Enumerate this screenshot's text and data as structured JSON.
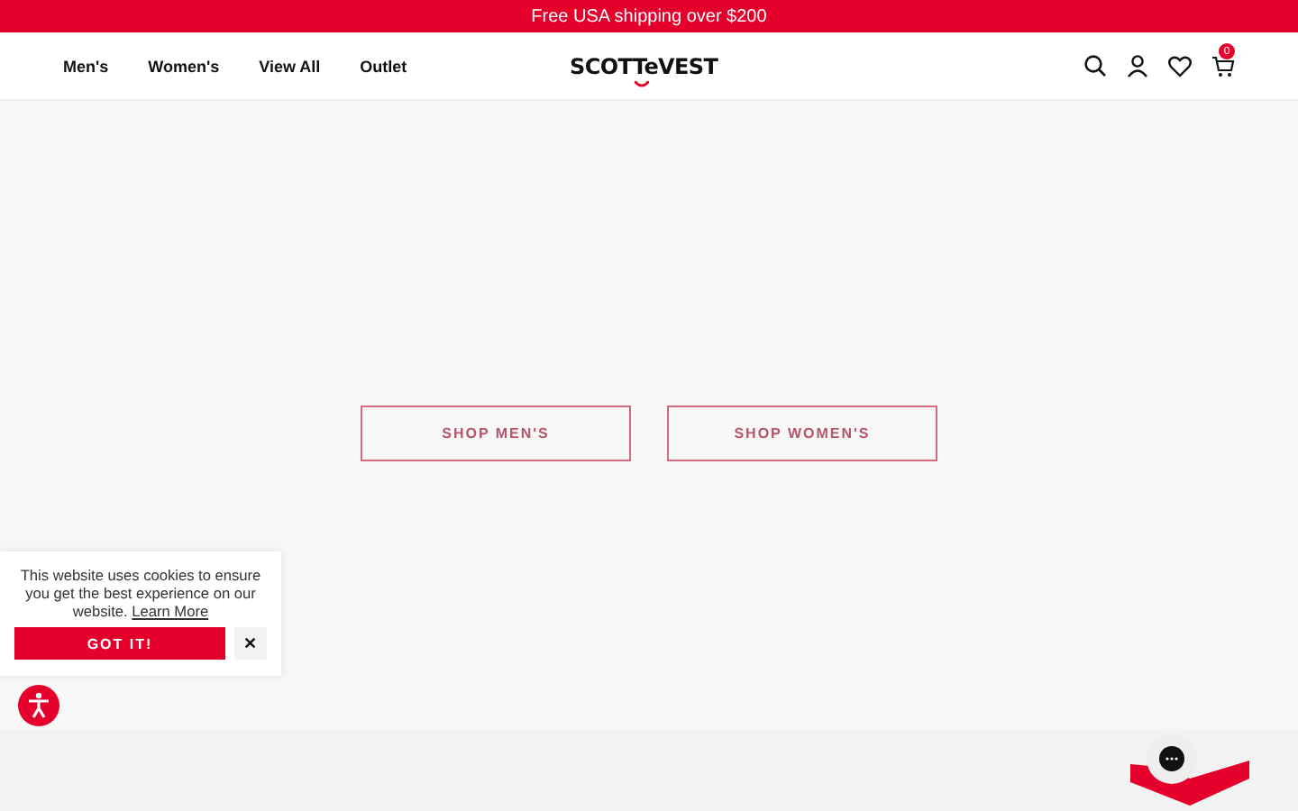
{
  "announcement": "Free USA shipping over $200",
  "nav": {
    "links": [
      "Men's",
      "Women's",
      "View All",
      "Outlet"
    ],
    "logo": "SCOTTeVEST",
    "cart_count": "0"
  },
  "hero": {
    "buttons": [
      "SHOP MEN'S",
      "SHOP WOMEN'S"
    ]
  },
  "cookie_banner": {
    "message": "This website uses cookies to ensure you get the best experience on our website.",
    "link": "Learn More",
    "accept": "GOT IT!",
    "close": "✕"
  }
}
